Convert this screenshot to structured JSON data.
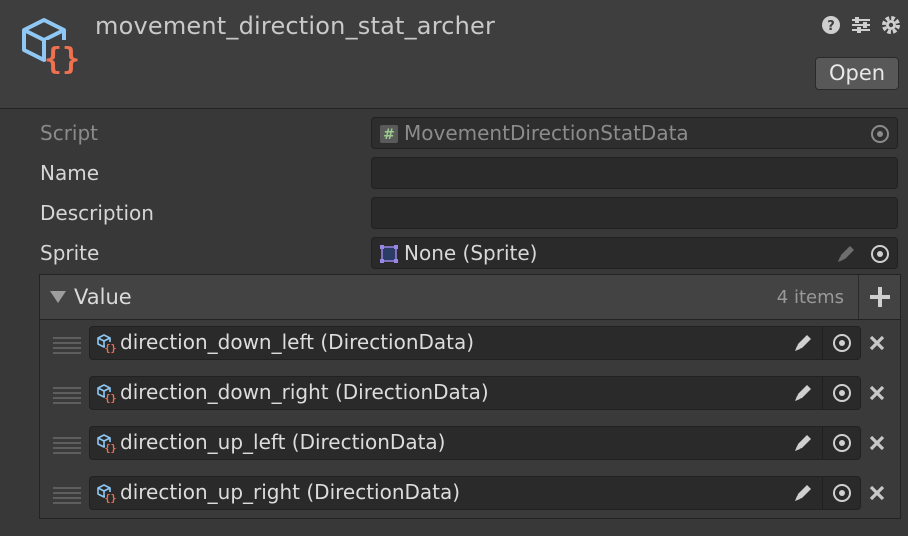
{
  "asset": {
    "title": "movement_direction_stat_archer",
    "icon": "scriptable-object-icon"
  },
  "header_icons": [
    "help-icon",
    "presets-icon",
    "settings-gear-icon"
  ],
  "open_label": "Open",
  "fields": {
    "script": {
      "label": "Script",
      "value": "MovementDirectionStatData",
      "icon": "script-hash-icon"
    },
    "name": {
      "label": "Name",
      "value": ""
    },
    "description": {
      "label": "Description",
      "value": ""
    },
    "sprite": {
      "label": "Sprite",
      "value": "None (Sprite)",
      "icon": "sprite-icon"
    }
  },
  "list": {
    "title": "Value",
    "count_label": "4 items",
    "items": [
      {
        "label": "direction_down_left (DirectionData)"
      },
      {
        "label": "direction_down_right (DirectionData)"
      },
      {
        "label": "direction_up_left (DirectionData)"
      },
      {
        "label": "direction_up_right (DirectionData)"
      }
    ]
  },
  "colors": {
    "accent_cube": "#8fc8f4",
    "accent_braces": "#f0714f",
    "background": "#383838"
  }
}
